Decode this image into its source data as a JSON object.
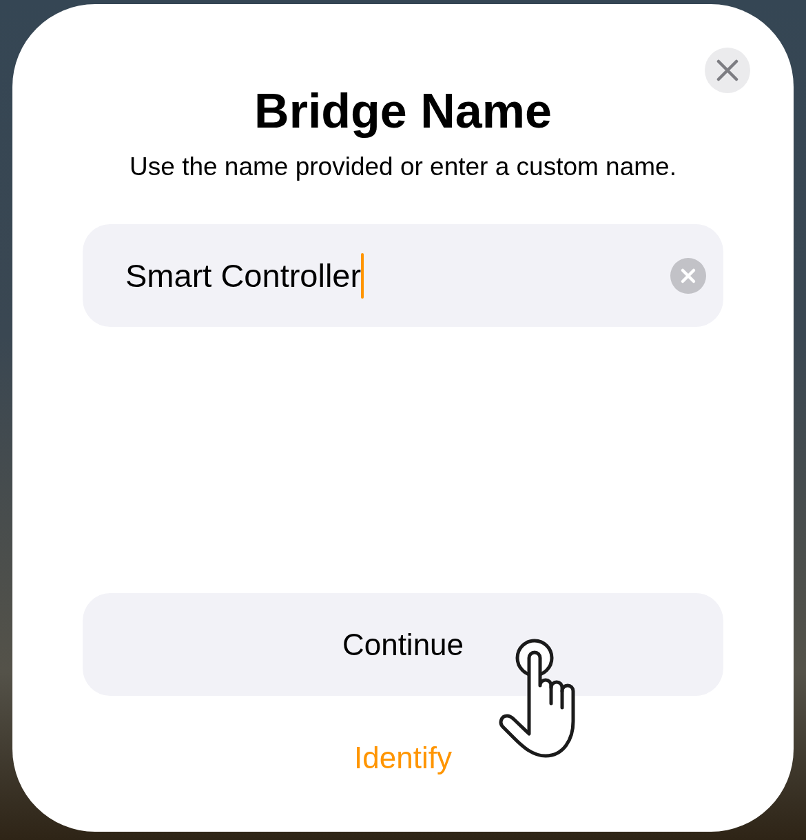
{
  "sheet": {
    "title": "Bridge Name",
    "subtitle": "Use the name provided or enter a custom name.",
    "name_field": {
      "value": "Smart Controller",
      "focused": true
    },
    "primary_button": {
      "label": "Continue"
    },
    "secondary_link": {
      "label": "Identify"
    }
  }
}
